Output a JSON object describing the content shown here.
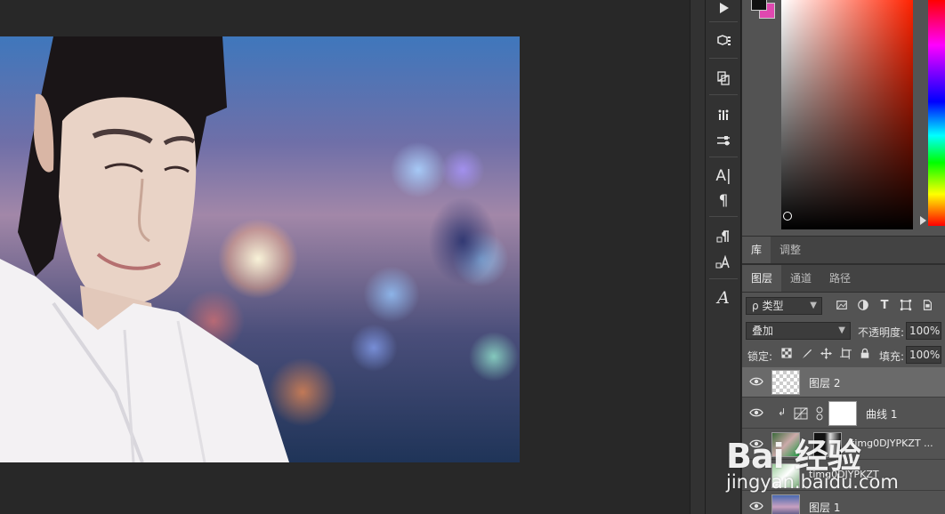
{
  "colors": {
    "foreground": "#111111",
    "background": "#e048b0",
    "picker_hue": "#ff2200"
  },
  "dock": {
    "icons": [
      "play-icon",
      "3d-cube-icon",
      "artboard-icon",
      "brush-icon",
      "adjust-sliders-icon",
      "character-icon",
      "paragraph-icon",
      "paragraph-styles-icon",
      "character-styles-icon",
      "glyphs-icon"
    ],
    "character_label": "A|",
    "paragraph_label": "¶",
    "glyph_label": "A"
  },
  "panel_tabs_top": [
    "库",
    "调整"
  ],
  "panel_tabs_layers": [
    "图层",
    "通道",
    "路径"
  ],
  "filter": {
    "kind_label": "类型",
    "kind_search_icon": "ρ"
  },
  "blend": {
    "mode": "叠加",
    "opacity_label": "不透明度:",
    "opacity_value": "100%"
  },
  "lock": {
    "label": "锁定:",
    "fill_label": "填充:",
    "fill_value": "100%"
  },
  "layers": [
    {
      "name": "图层 2",
      "selected": true
    },
    {
      "name": "曲线 1",
      "selected": false
    },
    {
      "name": "timg0DJYPKZT ...",
      "selected": false
    },
    {
      "name": "timg0DJYPKZT",
      "selected": false
    },
    {
      "name": "图层 1",
      "selected": false
    }
  ],
  "watermark": {
    "logo": "Bai 经验",
    "url": "jingyan.baidu.com"
  }
}
